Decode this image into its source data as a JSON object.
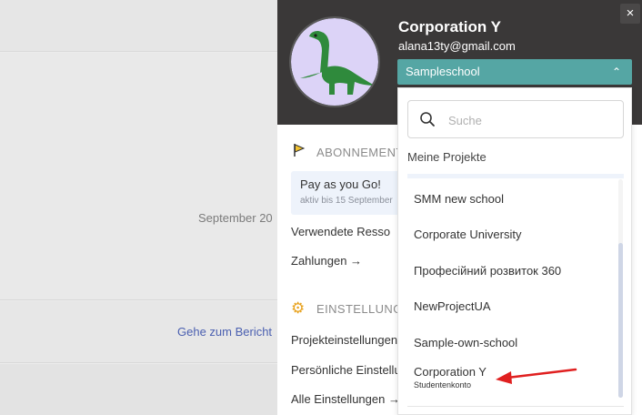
{
  "background": {
    "date_fragment": "September 20",
    "report_link": "Gehe zum Bericht"
  },
  "profile": {
    "company_name": "Corporation Y",
    "email": "alana13ty@gmail.com",
    "close_label": "×"
  },
  "school_select": {
    "selected": "Sampleschool",
    "chevron": "⌃"
  },
  "subscription": {
    "title": "ABONNEMENT",
    "plan_name": "Pay as you Go!",
    "plan_status": "aktiv bis 15 September",
    "used_resources": "Verwendete Resso",
    "payments": "Zahlungen →"
  },
  "settings": {
    "title": "EINSTELLUNGEN",
    "items": [
      "Projekteinstellungen",
      "Persönliche Einstellungen",
      "Alle Einstellungen →"
    ]
  },
  "dropdown": {
    "search_placeholder": "Suche",
    "group_label": "Meine Projekte",
    "projects": [
      {
        "name": "SMM new school"
      },
      {
        "name": "Corporate University"
      },
      {
        "name": "Професійний розвиток 360"
      },
      {
        "name": "NewProjectUA"
      },
      {
        "name": "Sample-own-school"
      },
      {
        "name": "Corporation Y",
        "sub": "Studentenkonto"
      }
    ]
  },
  "colors": {
    "accent": "#55a6a4",
    "header_bg": "#3a3838",
    "arrow": "#e02020"
  }
}
